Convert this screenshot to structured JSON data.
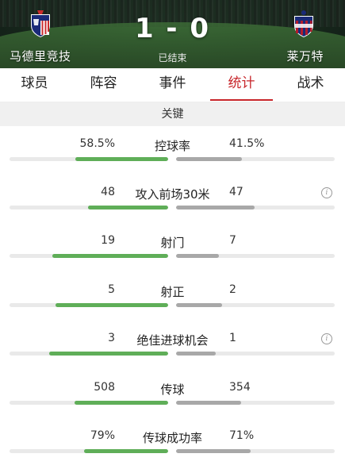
{
  "match": {
    "home_team": "马德里竞技",
    "away_team": "莱万特",
    "score": "1 - 0",
    "status": "已结束"
  },
  "tabs": [
    {
      "label": "球员",
      "active": false
    },
    {
      "label": "阵容",
      "active": false
    },
    {
      "label": "事件",
      "active": false
    },
    {
      "label": "统计",
      "active": true
    },
    {
      "label": "战术",
      "active": false
    }
  ],
  "section": {
    "title": "关键"
  },
  "colors": {
    "accent": "#c7252a",
    "home_bar": "#5fae58",
    "away_bar": "#a8a8a8",
    "track": "#e9e9e9"
  },
  "stats": [
    {
      "label": "控球率",
      "home": "58.5%",
      "away": "41.5%",
      "home_frac": 0.585,
      "away_frac": 0.415,
      "info": false
    },
    {
      "label": "攻入前场30米",
      "home": "48",
      "away": "47",
      "home_frac": 0.505,
      "away_frac": 0.495,
      "info": true
    },
    {
      "label": "射门",
      "home": "19",
      "away": "7",
      "home_frac": 0.73,
      "away_frac": 0.27,
      "info": false
    },
    {
      "label": "射正",
      "home": "5",
      "away": "2",
      "home_frac": 0.71,
      "away_frac": 0.29,
      "info": false
    },
    {
      "label": "绝佳进球机会",
      "home": "3",
      "away": "1",
      "home_frac": 0.75,
      "away_frac": 0.25,
      "info": true
    },
    {
      "label": "传球",
      "home": "508",
      "away": "354",
      "home_frac": 0.59,
      "away_frac": 0.41,
      "info": false
    },
    {
      "label": "传球成功率",
      "home": "79%",
      "away": "71%",
      "home_frac": 0.53,
      "away_frac": 0.47,
      "info": false
    }
  ]
}
